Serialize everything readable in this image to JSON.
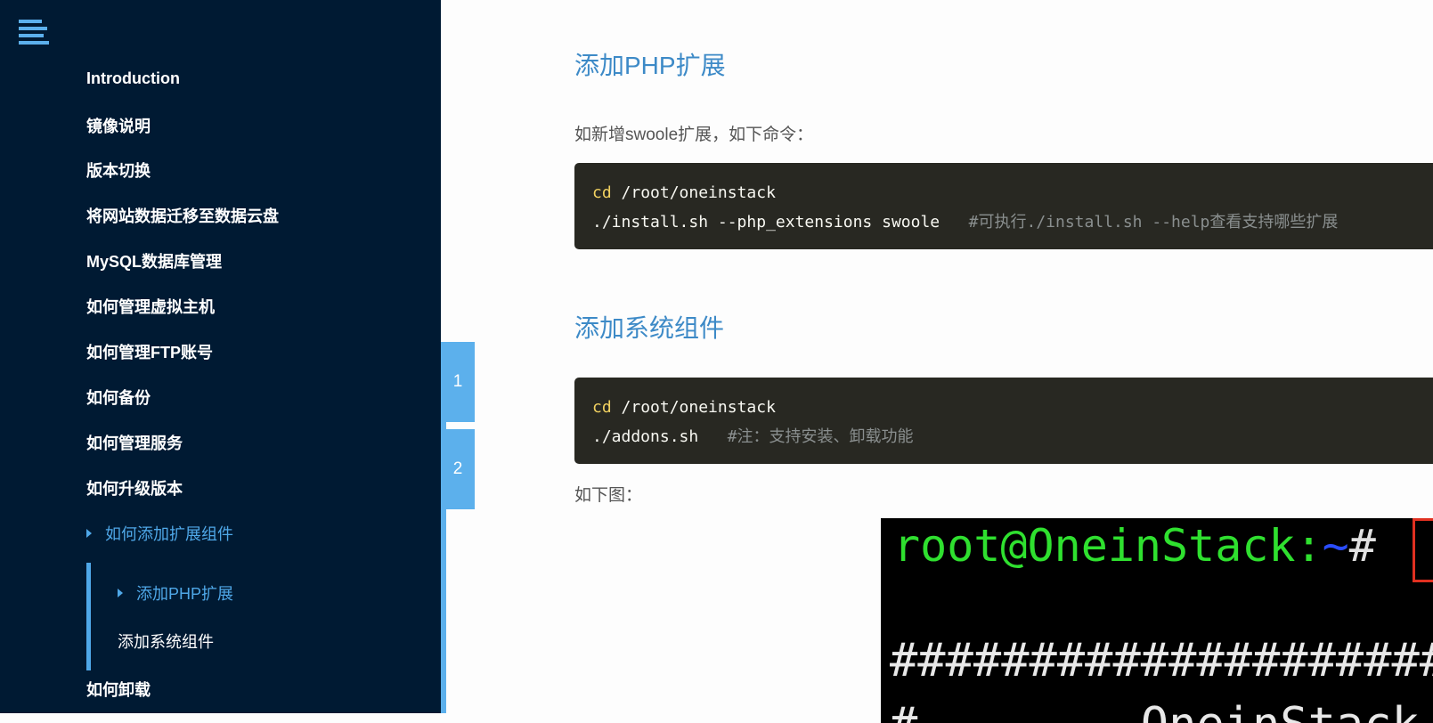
{
  "sidebar": {
    "items": [
      {
        "label": "Introduction"
      },
      {
        "label": "镜像说明"
      },
      {
        "label": "版本切换"
      },
      {
        "label": "将网站数据迁移至数据云盘"
      },
      {
        "label": "MySQL数据库管理"
      },
      {
        "label": "如何管理虚拟主机"
      },
      {
        "label": "如何管理FTP账号"
      },
      {
        "label": "如何备份"
      },
      {
        "label": "如何管理服务"
      },
      {
        "label": "如何升级版本"
      },
      {
        "label": "如何添加扩展组件"
      },
      {
        "label": "如何卸载"
      }
    ],
    "sub_items": [
      {
        "label": "添加PHP扩展"
      },
      {
        "label": "添加系统组件"
      }
    ]
  },
  "page_tabs": [
    "1",
    "2"
  ],
  "content": {
    "section1_title": "添加PHP扩展",
    "section1_intro": "如新增swoole扩展，如下命令：",
    "code1": {
      "line1_cmd": "cd",
      "line1_arg": " /root/oneinstack",
      "line2_cmd": "./install.sh --php_extensions swoole   ",
      "line2_comment": "#可执行./install.sh --help查看支持哪些扩展"
    },
    "section2_title": "添加系统组件",
    "code2": {
      "line1_cmd": "cd",
      "line1_arg": " /root/oneinstack",
      "line2_cmd": "./addons.sh   ",
      "line2_comment": "#注：支持安装、卸载功能"
    },
    "figure_caption": "如下图：",
    "terminal": {
      "prompt": "root@OneinStack:",
      "tilde": "~",
      "hash": "#",
      "hashes": "####################",
      "last_line": "#        OneinStack"
    }
  },
  "colors": {
    "sidebar_bg": "#001a33",
    "accent": "#4fa8e8",
    "heading": "#3d8ac7",
    "code_bg": "#282822"
  }
}
